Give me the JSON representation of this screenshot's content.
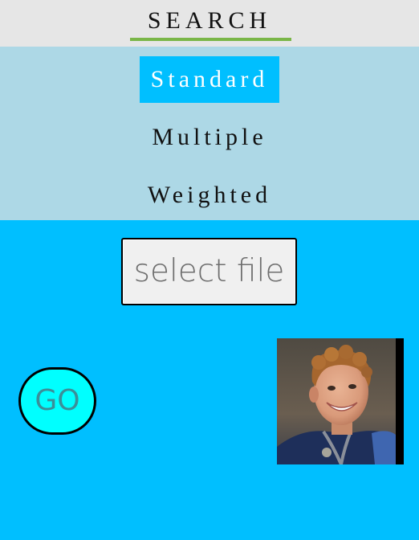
{
  "header": {
    "title": "SEARCH",
    "underline_color": "#7ab648"
  },
  "menu": {
    "items": [
      {
        "label": "Standard",
        "active": true
      },
      {
        "label": "Multiple",
        "active": false
      },
      {
        "label": "Weighted",
        "active": false
      }
    ]
  },
  "file_button": {
    "label": "select file"
  },
  "go_button": {
    "label": "GO"
  },
  "photo": {
    "subject": "portrait of a smiling man with curly hair"
  },
  "colors": {
    "page_background": "#00bfff",
    "header_background": "#e6e6e6",
    "menu_background": "#add8e6",
    "active_item_background": "#00bfff",
    "go_button_fill": "#00ffff"
  }
}
